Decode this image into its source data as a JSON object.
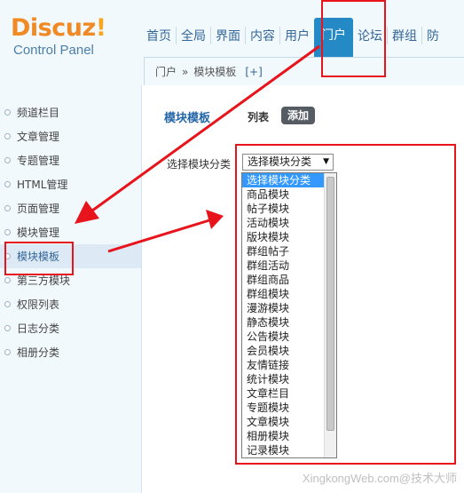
{
  "logo": {
    "name": "Discuz",
    "bang": "!",
    "subtitle": "Control Panel"
  },
  "nav": {
    "items": [
      {
        "label": "首页"
      },
      {
        "label": "全局"
      },
      {
        "label": "界面"
      },
      {
        "label": "内容"
      },
      {
        "label": "用户"
      },
      {
        "label": "门户",
        "active": true
      },
      {
        "label": "论坛"
      },
      {
        "label": "群组"
      },
      {
        "label": "防"
      }
    ]
  },
  "breadcrumb": {
    "root": "门户",
    "sep": "»",
    "current": "模块模板",
    "plus": "[+]"
  },
  "sidebar": {
    "items": [
      {
        "label": "频道栏目"
      },
      {
        "label": "文章管理"
      },
      {
        "label": "专题管理"
      },
      {
        "label": "HTML管理"
      },
      {
        "label": "页面管理"
      },
      {
        "label": "模块管理"
      },
      {
        "label": "模块模板",
        "active": true
      },
      {
        "label": "第三方模块"
      },
      {
        "label": "权限列表"
      },
      {
        "label": "日志分类"
      },
      {
        "label": "相册分类"
      }
    ]
  },
  "main": {
    "title": "模块模板",
    "tab_list": "列表",
    "tab_add": "添加",
    "filter_label": "选择模块分类",
    "select_value": "选择模块分类",
    "select_arrow": "▼",
    "options": [
      "选择模块分类",
      "商品模块",
      "帖子模块",
      "活动模块",
      "版块模块",
      "群组帖子",
      "群组活动",
      "群组商品",
      "群组模块",
      "漫游模块",
      "静态模块",
      "公告模块",
      "会员模块",
      "友情链接",
      "统计模块",
      "文章栏目",
      "专题模块",
      "文章模块",
      "相册模块",
      "记录模块"
    ]
  },
  "annotation": {
    "color": "#e8141b"
  },
  "watermark": "XingkongWeb.com@技术大师"
}
